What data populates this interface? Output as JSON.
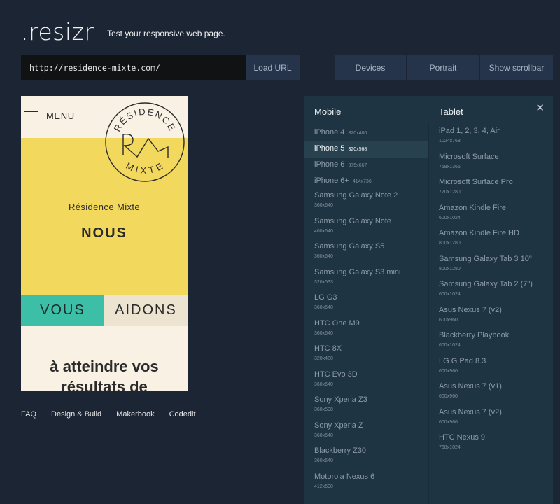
{
  "header": {
    "logo": ".resizr",
    "tagline": "Test your responsive web page."
  },
  "toolbar": {
    "url_value": "http://residence-mixte.com/",
    "load_label": "Load URL",
    "devices_label": "Devices",
    "portrait_label": "Portrait",
    "scrollbar_label": "Show scrollbar"
  },
  "preview": {
    "menu_label": "MENU",
    "seal_text_top": "RÉSIDENCE",
    "seal_text_bottom": "MIXTE",
    "subtitle": "Résidence Mixte",
    "heading": "NOUS",
    "vous": "VOUS",
    "aidons": "AIDONS",
    "body_line1": "à atteindre vos",
    "body_line2": "résultats de",
    "colors": {
      "yellow": "#f2d85c",
      "teal": "#3cbfa6",
      "cream": "#f8f1e4"
    }
  },
  "footer": {
    "links": [
      "FAQ",
      "Design & Build",
      "Makerbook",
      "Codedit"
    ]
  },
  "panel": {
    "close_icon": "close-icon",
    "mobile_title": "Mobile",
    "tablet_title": "Tablet",
    "mobile": [
      {
        "name": "iPhone 4",
        "size": "320x480"
      },
      {
        "name": "iPhone 5",
        "size": "320x568"
      },
      {
        "name": "iPhone 6",
        "size": "375x667"
      },
      {
        "name": "iPhone 6+",
        "size": "414x736"
      },
      {
        "name": "Samsung Galaxy Note 2",
        "size": "360x640"
      },
      {
        "name": "Samsung Galaxy Note",
        "size": "400x640"
      },
      {
        "name": "Samsung Galaxy S5",
        "size": "360x640"
      },
      {
        "name": "Samsung Galaxy S3 mini",
        "size": "320x533"
      },
      {
        "name": "LG G3",
        "size": "360x640"
      },
      {
        "name": "HTC One M9",
        "size": "360x640"
      },
      {
        "name": "HTC 8X",
        "size": "320x480"
      },
      {
        "name": "HTC Evo 3D",
        "size": "360x640"
      },
      {
        "name": "Sony Xperia Z3",
        "size": "360x598"
      },
      {
        "name": "Sony Xperia Z",
        "size": "360x640"
      },
      {
        "name": "Blackberry Z30",
        "size": "360x640"
      },
      {
        "name": "Motorola Nexus 6",
        "size": "412x690"
      }
    ],
    "tablet": [
      {
        "name": "iPad 1, 2, 3, 4, Air",
        "size": "1024x768"
      },
      {
        "name": "Microsoft Surface",
        "size": "768x1366"
      },
      {
        "name": "Microsoft Surface Pro",
        "size": "720x1280"
      },
      {
        "name": "Amazon Kindle Fire",
        "size": "600x1024"
      },
      {
        "name": "Amazon Kindle Fire HD",
        "size": "800x1280"
      },
      {
        "name": "Samsung Galaxy Tab 3 10\"",
        "size": "800x1280"
      },
      {
        "name": "Samsung Galaxy Tab 2 (7\")",
        "size": "600x1024"
      },
      {
        "name": "Asus Nexus 7 (v2)",
        "size": "600x960"
      },
      {
        "name": "Blackberry Playbook",
        "size": "600x1024"
      },
      {
        "name": "LG G Pad 8.3",
        "size": "600x960"
      },
      {
        "name": "Asus Nexus 7 (v1)",
        "size": "600x960"
      },
      {
        "name": "Asus Nexus 7 (v2)",
        "size": "600x966"
      },
      {
        "name": "HTC Nexus 9",
        "size": "768x1024"
      }
    ],
    "active_mobile": "iPhone 5"
  }
}
